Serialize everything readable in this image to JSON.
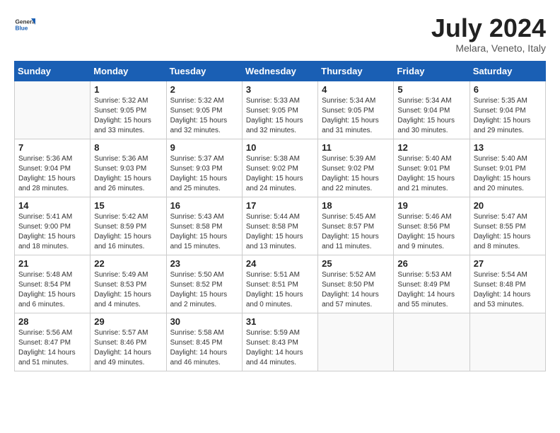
{
  "header": {
    "logo": {
      "general": "General",
      "blue": "Blue"
    },
    "title": "July 2024",
    "location": "Melara, Veneto, Italy"
  },
  "weekdays": [
    "Sunday",
    "Monday",
    "Tuesday",
    "Wednesday",
    "Thursday",
    "Friday",
    "Saturday"
  ],
  "weeks": [
    [
      {
        "day": "",
        "info": ""
      },
      {
        "day": "1",
        "info": "Sunrise: 5:32 AM\nSunset: 9:05 PM\nDaylight: 15 hours\nand 33 minutes."
      },
      {
        "day": "2",
        "info": "Sunrise: 5:32 AM\nSunset: 9:05 PM\nDaylight: 15 hours\nand 32 minutes."
      },
      {
        "day": "3",
        "info": "Sunrise: 5:33 AM\nSunset: 9:05 PM\nDaylight: 15 hours\nand 32 minutes."
      },
      {
        "day": "4",
        "info": "Sunrise: 5:34 AM\nSunset: 9:05 PM\nDaylight: 15 hours\nand 31 minutes."
      },
      {
        "day": "5",
        "info": "Sunrise: 5:34 AM\nSunset: 9:04 PM\nDaylight: 15 hours\nand 30 minutes."
      },
      {
        "day": "6",
        "info": "Sunrise: 5:35 AM\nSunset: 9:04 PM\nDaylight: 15 hours\nand 29 minutes."
      }
    ],
    [
      {
        "day": "7",
        "info": "Sunrise: 5:36 AM\nSunset: 9:04 PM\nDaylight: 15 hours\nand 28 minutes."
      },
      {
        "day": "8",
        "info": "Sunrise: 5:36 AM\nSunset: 9:03 PM\nDaylight: 15 hours\nand 26 minutes."
      },
      {
        "day": "9",
        "info": "Sunrise: 5:37 AM\nSunset: 9:03 PM\nDaylight: 15 hours\nand 25 minutes."
      },
      {
        "day": "10",
        "info": "Sunrise: 5:38 AM\nSunset: 9:02 PM\nDaylight: 15 hours\nand 24 minutes."
      },
      {
        "day": "11",
        "info": "Sunrise: 5:39 AM\nSunset: 9:02 PM\nDaylight: 15 hours\nand 22 minutes."
      },
      {
        "day": "12",
        "info": "Sunrise: 5:40 AM\nSunset: 9:01 PM\nDaylight: 15 hours\nand 21 minutes."
      },
      {
        "day": "13",
        "info": "Sunrise: 5:40 AM\nSunset: 9:01 PM\nDaylight: 15 hours\nand 20 minutes."
      }
    ],
    [
      {
        "day": "14",
        "info": "Sunrise: 5:41 AM\nSunset: 9:00 PM\nDaylight: 15 hours\nand 18 minutes."
      },
      {
        "day": "15",
        "info": "Sunrise: 5:42 AM\nSunset: 8:59 PM\nDaylight: 15 hours\nand 16 minutes."
      },
      {
        "day": "16",
        "info": "Sunrise: 5:43 AM\nSunset: 8:58 PM\nDaylight: 15 hours\nand 15 minutes."
      },
      {
        "day": "17",
        "info": "Sunrise: 5:44 AM\nSunset: 8:58 PM\nDaylight: 15 hours\nand 13 minutes."
      },
      {
        "day": "18",
        "info": "Sunrise: 5:45 AM\nSunset: 8:57 PM\nDaylight: 15 hours\nand 11 minutes."
      },
      {
        "day": "19",
        "info": "Sunrise: 5:46 AM\nSunset: 8:56 PM\nDaylight: 15 hours\nand 9 minutes."
      },
      {
        "day": "20",
        "info": "Sunrise: 5:47 AM\nSunset: 8:55 PM\nDaylight: 15 hours\nand 8 minutes."
      }
    ],
    [
      {
        "day": "21",
        "info": "Sunrise: 5:48 AM\nSunset: 8:54 PM\nDaylight: 15 hours\nand 6 minutes."
      },
      {
        "day": "22",
        "info": "Sunrise: 5:49 AM\nSunset: 8:53 PM\nDaylight: 15 hours\nand 4 minutes."
      },
      {
        "day": "23",
        "info": "Sunrise: 5:50 AM\nSunset: 8:52 PM\nDaylight: 15 hours\nand 2 minutes."
      },
      {
        "day": "24",
        "info": "Sunrise: 5:51 AM\nSunset: 8:51 PM\nDaylight: 15 hours\nand 0 minutes."
      },
      {
        "day": "25",
        "info": "Sunrise: 5:52 AM\nSunset: 8:50 PM\nDaylight: 14 hours\nand 57 minutes."
      },
      {
        "day": "26",
        "info": "Sunrise: 5:53 AM\nSunset: 8:49 PM\nDaylight: 14 hours\nand 55 minutes."
      },
      {
        "day": "27",
        "info": "Sunrise: 5:54 AM\nSunset: 8:48 PM\nDaylight: 14 hours\nand 53 minutes."
      }
    ],
    [
      {
        "day": "28",
        "info": "Sunrise: 5:56 AM\nSunset: 8:47 PM\nDaylight: 14 hours\nand 51 minutes."
      },
      {
        "day": "29",
        "info": "Sunrise: 5:57 AM\nSunset: 8:46 PM\nDaylight: 14 hours\nand 49 minutes."
      },
      {
        "day": "30",
        "info": "Sunrise: 5:58 AM\nSunset: 8:45 PM\nDaylight: 14 hours\nand 46 minutes."
      },
      {
        "day": "31",
        "info": "Sunrise: 5:59 AM\nSunset: 8:43 PM\nDaylight: 14 hours\nand 44 minutes."
      },
      {
        "day": "",
        "info": ""
      },
      {
        "day": "",
        "info": ""
      },
      {
        "day": "",
        "info": ""
      }
    ]
  ]
}
